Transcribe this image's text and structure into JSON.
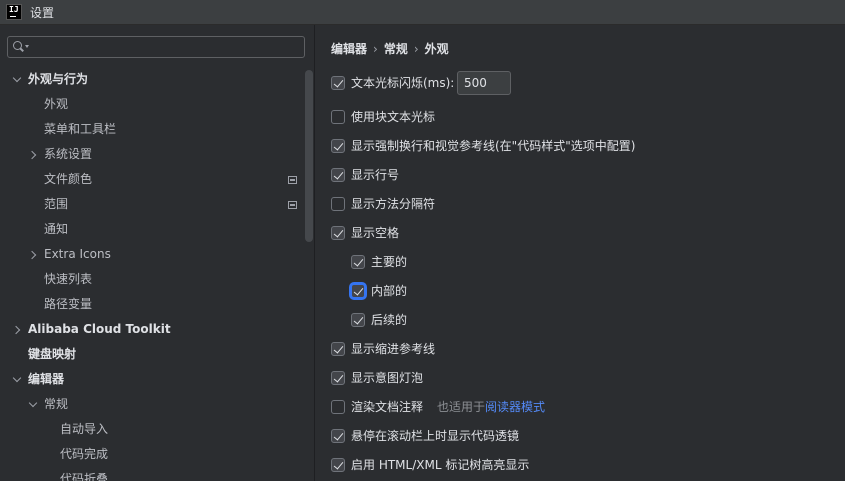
{
  "window": {
    "title": "设置",
    "logo_text": "IJ"
  },
  "search": {
    "value": "",
    "placeholder": ""
  },
  "tree": [
    {
      "label": "外观与行为",
      "level": 0,
      "arrow": "down",
      "bold": true
    },
    {
      "label": "外观",
      "level": 1,
      "arrow": "none"
    },
    {
      "label": "菜单和工具栏",
      "level": 1,
      "arrow": "none"
    },
    {
      "label": "系统设置",
      "level": 1,
      "arrow": "right"
    },
    {
      "label": "文件颜色",
      "level": 1,
      "arrow": "none",
      "project_icon": true
    },
    {
      "label": "范围",
      "level": 1,
      "arrow": "none",
      "project_icon": true
    },
    {
      "label": "通知",
      "level": 1,
      "arrow": "none"
    },
    {
      "label": "Extra Icons",
      "level": 1,
      "arrow": "right"
    },
    {
      "label": "快速列表",
      "level": 1,
      "arrow": "none"
    },
    {
      "label": "路径变量",
      "level": 1,
      "arrow": "none"
    },
    {
      "label": "Alibaba Cloud Toolkit",
      "level": 0,
      "arrow": "right",
      "bold": true
    },
    {
      "label": "键盘映射",
      "level": 0,
      "arrow": "none",
      "bold": true
    },
    {
      "label": "编辑器",
      "level": 0,
      "arrow": "down",
      "bold": true
    },
    {
      "label": "常规",
      "level": 1,
      "arrow": "down"
    },
    {
      "label": "自动导入",
      "level": 2,
      "arrow": "none"
    },
    {
      "label": "代码完成",
      "level": 2,
      "arrow": "none"
    },
    {
      "label": "代码折叠",
      "level": 2,
      "arrow": "none"
    }
  ],
  "breadcrumb": [
    "编辑器",
    "常规",
    "外观"
  ],
  "breadcrumb_sep": "›",
  "options": {
    "caret_blink": {
      "label": "文本光标闪烁(ms):",
      "checked": true,
      "value": "500"
    },
    "block_caret": {
      "label": "使用块文本光标",
      "checked": false
    },
    "hard_wraps": {
      "label": "显示强制换行和视觉参考线(在\"代码样式\"选项中配置)",
      "checked": true
    },
    "line_numbers": {
      "label": "显示行号",
      "checked": true
    },
    "method_separators": {
      "label": "显示方法分隔符",
      "checked": false
    },
    "whitespaces": {
      "label": "显示空格",
      "checked": true
    },
    "leading": {
      "label": "主要的",
      "checked": true
    },
    "inner": {
      "label": "内部的",
      "checked": true,
      "focused": true
    },
    "trailing": {
      "label": "后续的",
      "checked": true
    },
    "indent_guides": {
      "label": "显示缩进参考线",
      "checked": true
    },
    "intention_bulb": {
      "label": "显示意图灯泡",
      "checked": true
    },
    "render_docs": {
      "label": "渲染文档注释",
      "checked": false,
      "note": "也适用于",
      "link": "阅读器模式"
    },
    "code_lens": {
      "label": "悬停在滚动栏上时显示代码透镜",
      "checked": true
    },
    "tag_tree": {
      "label": "启用 HTML/XML 标记树高亮显示",
      "checked": true
    }
  }
}
